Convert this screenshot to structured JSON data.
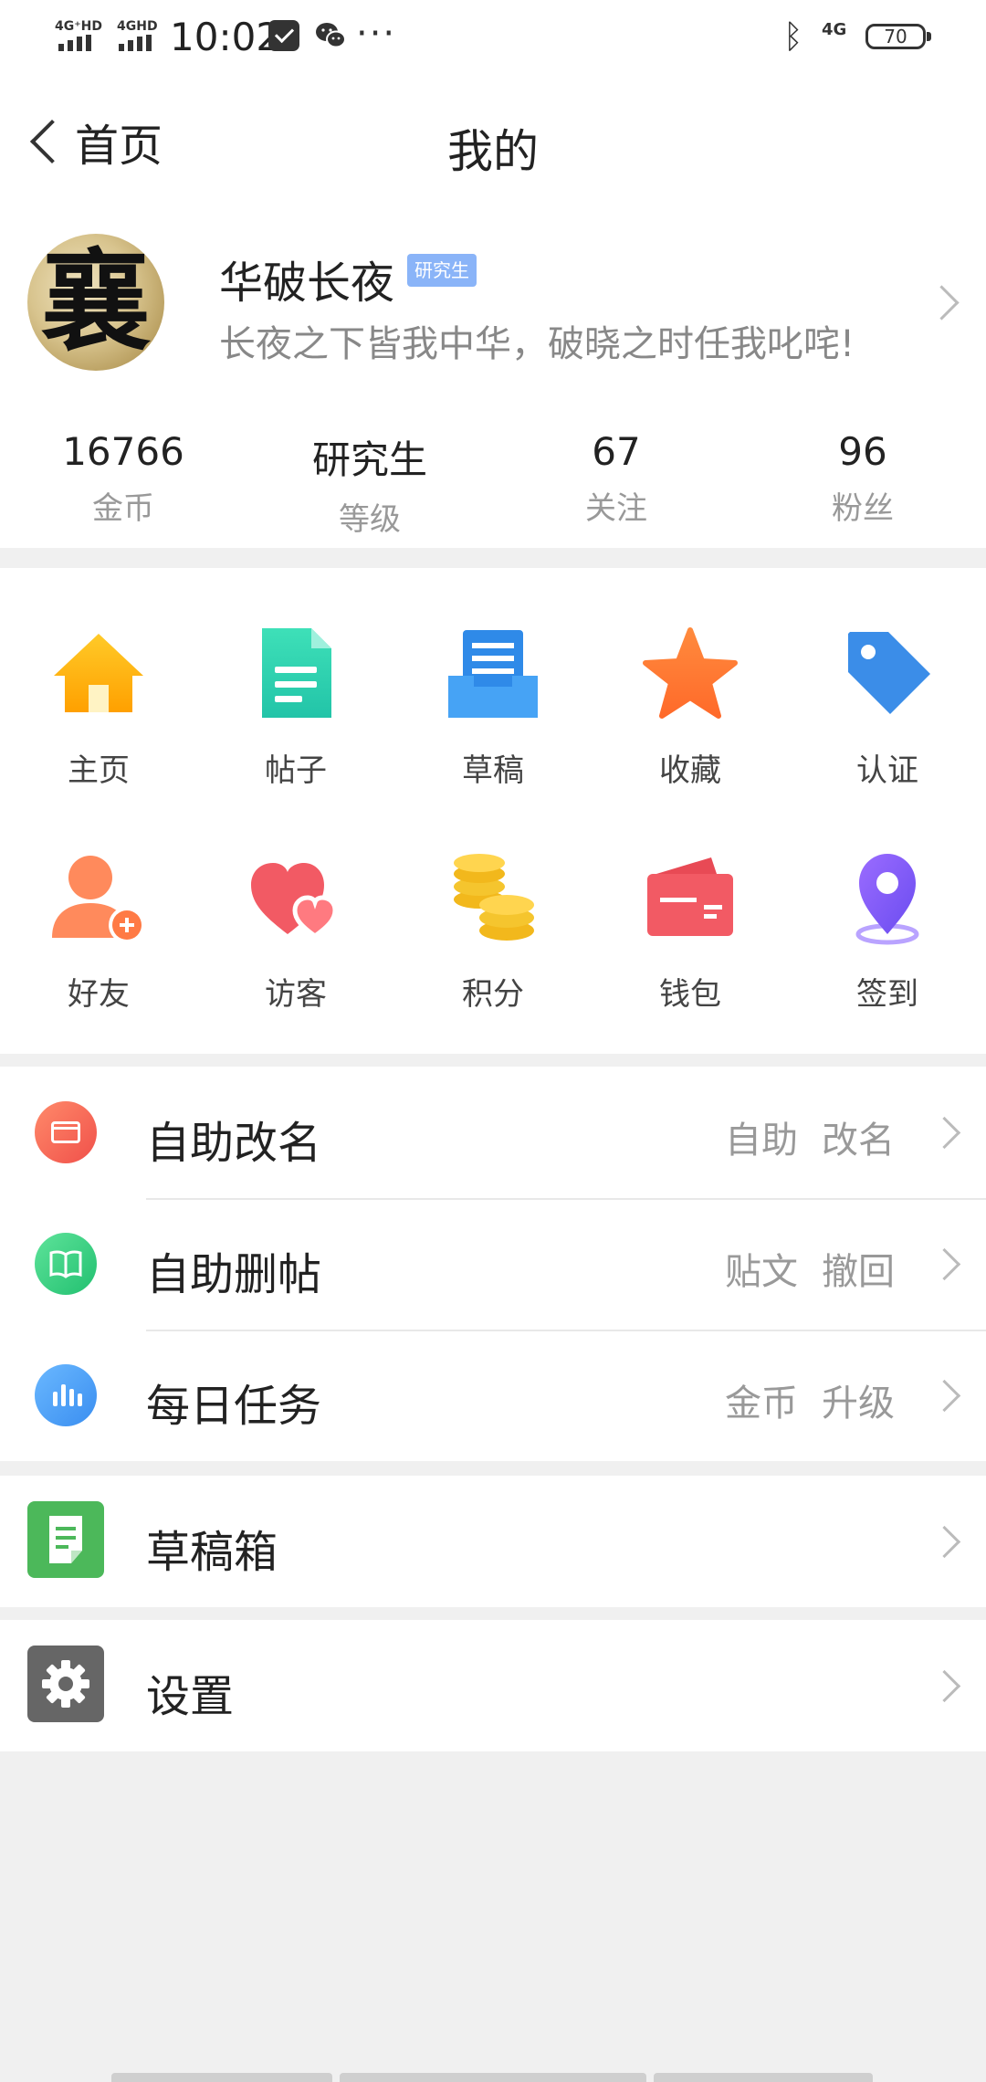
{
  "status_bar": {
    "signal1": "4G⁺HD",
    "signal2": "4GHD",
    "time": "10:02",
    "network": "4G",
    "battery": "70"
  },
  "header": {
    "back_label": "首页",
    "title": "我的"
  },
  "profile": {
    "username": "华破长夜",
    "badge": "研究生",
    "signature": "长夜之下皆我中华，破晓之时任我叱咤!",
    "stats": [
      {
        "value": "16766",
        "label": "金币"
      },
      {
        "value": "研究生",
        "label": "等级"
      },
      {
        "value": "67",
        "label": "关注"
      },
      {
        "value": "96",
        "label": "粉丝"
      }
    ]
  },
  "grid": {
    "items": [
      {
        "label": "主页",
        "icon": "home-icon"
      },
      {
        "label": "帖子",
        "icon": "document-icon"
      },
      {
        "label": "草稿",
        "icon": "draft-tray-icon"
      },
      {
        "label": "收藏",
        "icon": "star-icon"
      },
      {
        "label": "认证",
        "icon": "tag-icon"
      },
      {
        "label": "好友",
        "icon": "add-friend-icon"
      },
      {
        "label": "访客",
        "icon": "hearts-icon"
      },
      {
        "label": "积分",
        "icon": "coins-icon"
      },
      {
        "label": "钱包",
        "icon": "wallet-icon"
      },
      {
        "label": "签到",
        "icon": "location-pin-icon"
      }
    ]
  },
  "menu": {
    "rows": [
      {
        "title": "自助改名",
        "tag1": "自助",
        "tag2": "改名",
        "icon": "card-icon",
        "color": "#f0604a"
      },
      {
        "title": "自助删帖",
        "tag1": "贴文",
        "tag2": "撤回",
        "icon": "book-icon",
        "color": "#35c97a"
      },
      {
        "title": "每日任务",
        "tag1": "金币",
        "tag2": "升级",
        "icon": "bar-chart-icon",
        "color": "#4a9af0"
      }
    ],
    "drafts": {
      "title": "草稿箱",
      "icon": "note-icon",
      "color": "#4cb85a"
    },
    "settings": {
      "title": "设置",
      "icon": "gear-icon",
      "color": "#666666"
    }
  }
}
